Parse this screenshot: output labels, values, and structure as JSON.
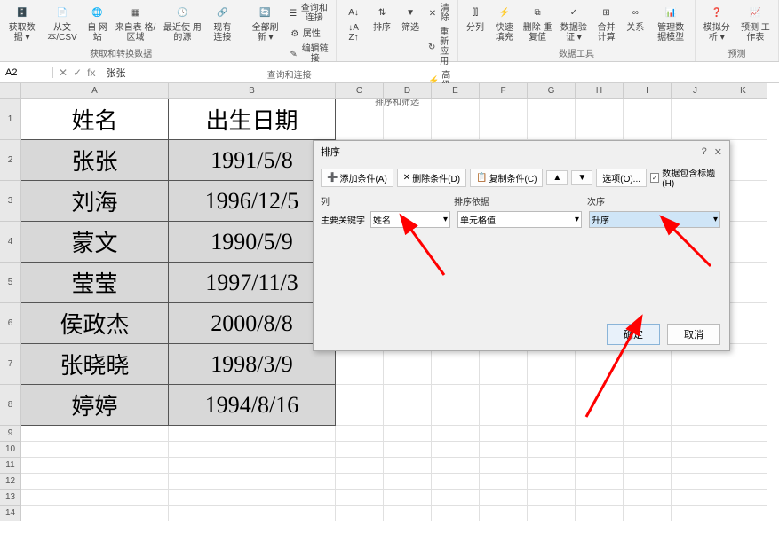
{
  "ribbon": {
    "groups": [
      {
        "label": "获取和转换数据",
        "buttons": [
          {
            "label": "获取数\n据 ▾"
          },
          {
            "label": "从文\n本/CSV"
          },
          {
            "label": "自\n网站"
          },
          {
            "label": "来自表\n格/区域"
          },
          {
            "label": "最近使\n用的源"
          },
          {
            "label": "现有\n连接"
          }
        ]
      },
      {
        "label": "查询和连接",
        "buttons": [
          {
            "label": "全部刷\n新 ▾"
          }
        ],
        "small": [
          {
            "label": "查询和连接"
          },
          {
            "label": "属性"
          },
          {
            "label": "编辑链接"
          }
        ]
      },
      {
        "label": "排序和筛选",
        "buttons": [
          {
            "label": "↓A\nZ↑"
          },
          {
            "label": "排序"
          },
          {
            "label": "筛选"
          }
        ],
        "small": [
          {
            "label": "清除"
          },
          {
            "label": "重新应用"
          },
          {
            "label": "高级"
          }
        ]
      },
      {
        "label": "数据工具",
        "buttons": [
          {
            "label": "分列"
          },
          {
            "label": "快速填充"
          },
          {
            "label": "删除\n重复值"
          },
          {
            "label": "数据验\n证 ▾"
          },
          {
            "label": "合并计算"
          },
          {
            "label": "关系"
          },
          {
            "label": "管理数\n据模型"
          }
        ]
      },
      {
        "label": "预测",
        "buttons": [
          {
            "label": "模拟分析\n▾"
          },
          {
            "label": "预测\n工作表"
          }
        ]
      }
    ]
  },
  "formula_bar": {
    "name_box": "A2",
    "value": "张张"
  },
  "grid": {
    "columns": [
      "A",
      "B",
      "C",
      "D",
      "E",
      "F",
      "G",
      "H",
      "I",
      "J",
      "K"
    ],
    "data_headers": [
      "姓名",
      "出生日期"
    ],
    "data_rows": [
      [
        "张张",
        "1991/5/8"
      ],
      [
        "刘海",
        "1996/12/5"
      ],
      [
        "蒙文",
        "1990/5/9"
      ],
      [
        "莹莹",
        "1997/11/3"
      ],
      [
        "侯政杰",
        "2000/8/8"
      ],
      [
        "张晓晓",
        "1998/3/9"
      ],
      [
        "婷婷",
        "1994/8/16"
      ]
    ]
  },
  "dialog": {
    "title": "排序",
    "toolbar": {
      "add": "添加条件(A)",
      "delete": "删除条件(D)",
      "copy": "复制条件(C)",
      "options": "选项(O)...",
      "checkbox_label": "数据包含标题(H)"
    },
    "grid_headers": {
      "col1": "列",
      "col2": "排序依据",
      "col3": "次序"
    },
    "row": {
      "label": "主要关键字",
      "sort_by": "姓名",
      "sort_on": "单元格值",
      "order": "升序"
    },
    "footer": {
      "ok": "确定",
      "cancel": "取消"
    }
  }
}
